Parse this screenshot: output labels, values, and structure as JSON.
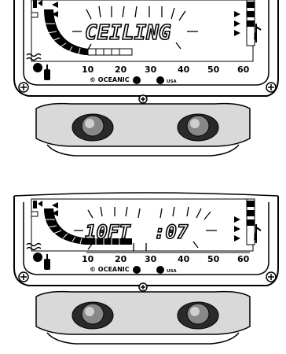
{
  "panels": [
    {
      "id": "ceiling",
      "display_text": "CEILING",
      "scale_labels": [
        "10",
        "20",
        "30",
        "40",
        "50",
        "60"
      ],
      "brand": "© OCEANIC",
      "country": "USA"
    },
    {
      "id": "ceiling-depth-time",
      "display_depth": "10FT",
      "display_time": ":07",
      "scale_labels": [
        "10",
        "20",
        "30",
        "40",
        "50",
        "60"
      ],
      "brand": "© OCEANIC",
      "country": "USA"
    }
  ]
}
